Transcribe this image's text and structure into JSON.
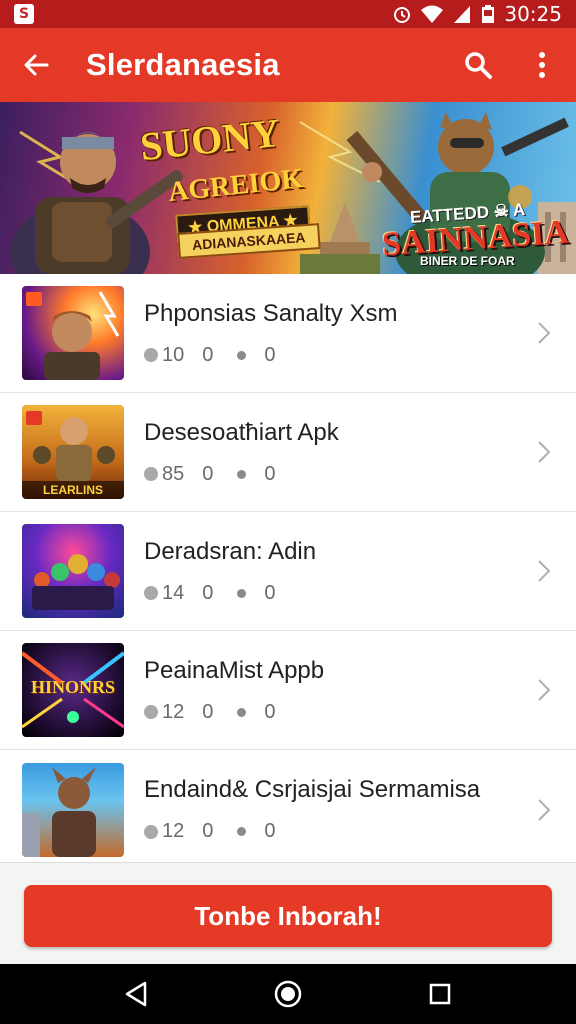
{
  "status_bar": {
    "time": "30:25",
    "icons": [
      "app-notification-icon",
      "alarm-icon",
      "wifi-icon",
      "signal-icon",
      "battery-icon"
    ]
  },
  "app_bar": {
    "title": "Slerdanaesia",
    "icons": [
      "back-arrow-icon",
      "search-icon",
      "more-vert-icon"
    ],
    "color": "#e53928"
  },
  "banner": {
    "title_line1": "SUONY",
    "title_line2": "AGREIOK",
    "ribbon_line1": "★ OMMENA ★",
    "ribbon_line2": "ADIANASKAAEA",
    "right_line1": "EATTEDD ☠ A",
    "right_line2": "SAINNASIA",
    "right_line3": "BINER DE FOAR"
  },
  "items": [
    {
      "title": "Phponsias Sanalty Xsm",
      "count": "10",
      "val1": "0",
      "val2": "0",
      "thumb_label": "",
      "thumb_big": ""
    },
    {
      "title": "Desesoatħiart Apk",
      "count": "85",
      "val1": "0",
      "val2": "0",
      "thumb_label": "LEARLINS",
      "thumb_big": ""
    },
    {
      "title": "Deradsran: Adin",
      "count": "14",
      "val1": "0",
      "val2": "0",
      "thumb_label": "",
      "thumb_big": ""
    },
    {
      "title": "PeainaMist Appb",
      "count": "12",
      "val1": "0",
      "val2": "0",
      "thumb_label": "",
      "thumb_big": "HINONRS"
    },
    {
      "title": "Endaind& Csrjaisjai Sermamisa",
      "count": "12",
      "val1": "0",
      "val2": "0",
      "thumb_label": "",
      "thumb_big": ""
    }
  ],
  "cta": {
    "label": "Tonbe Inborah!",
    "color": "#e43a26"
  },
  "nav_bar": {
    "icons": [
      "back-triangle-icon",
      "home-circle-icon",
      "recents-square-icon"
    ]
  }
}
